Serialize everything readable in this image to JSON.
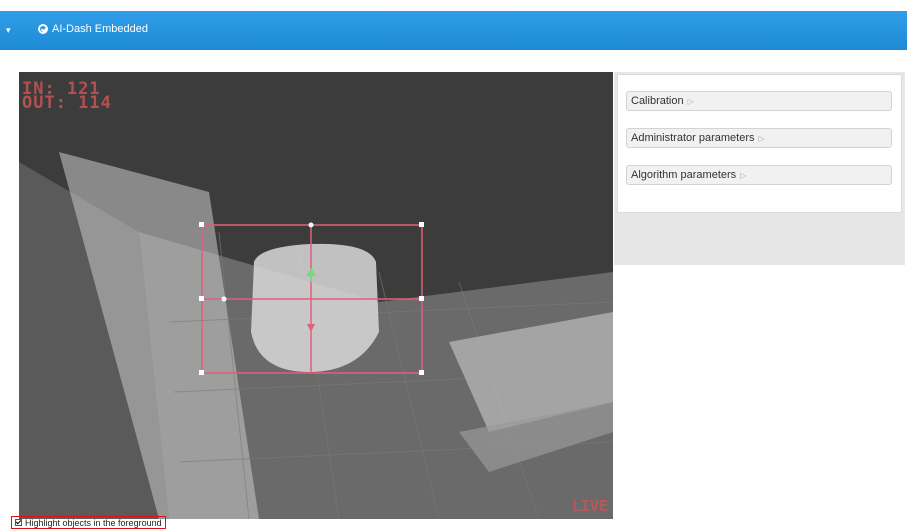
{
  "header": {
    "app_title": "AI-Dash Embedded",
    "menu_icon": "caret-down-icon",
    "brand_icon": "check-circle-icon"
  },
  "video": {
    "in_label": "IN: 121",
    "out_label": "OUT: 114",
    "live_label": "LIVE"
  },
  "params": {
    "calibration": "Calibration",
    "administrator": "Administrator parameters",
    "algorithm": "Algorithm parameters",
    "arrow_icon": "triangle-right-icon"
  },
  "footer": {
    "highlight_label": "Highlight objects in the foreground",
    "highlight_checked": true
  }
}
